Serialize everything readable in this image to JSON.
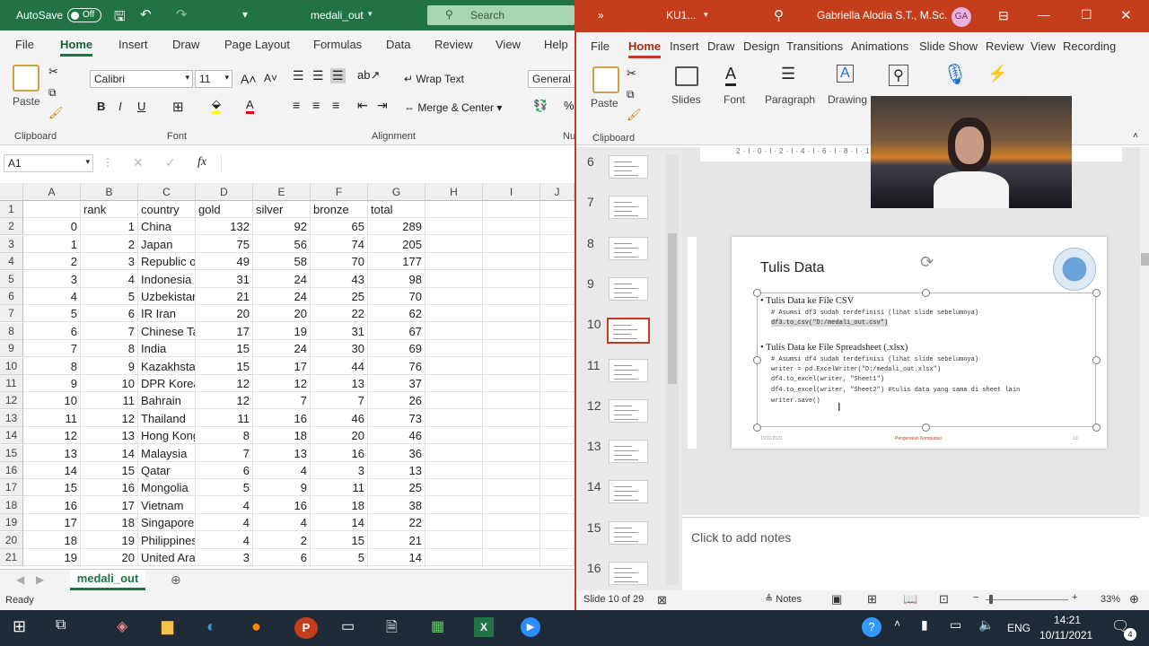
{
  "excel": {
    "title": {
      "autosave": "AutoSave",
      "toggle": "Off",
      "filename": "medali_out",
      "search": "Search"
    },
    "menu": [
      "File",
      "Home",
      "Insert",
      "Draw",
      "Page Layout",
      "Formulas",
      "Data",
      "Review",
      "View",
      "Help"
    ],
    "ribbon": {
      "paste": "Paste",
      "clipboard": "Clipboard",
      "font_name": "Calibri",
      "font_size": "11",
      "font": "Font",
      "wrap": "Wrap Text",
      "merge": "Merge & Center",
      "alignment": "Alignment",
      "number_format": "General",
      "number": "Nu"
    },
    "namebox": "A1",
    "fx": "fx",
    "columns": [
      "A",
      "B",
      "C",
      "D",
      "E",
      "F",
      "G",
      "H",
      "I",
      "J"
    ],
    "header_row": [
      "",
      "rank",
      "country",
      "gold",
      "silver",
      "bronze",
      "total"
    ],
    "rows": [
      [
        "0",
        "1",
        "China",
        "132",
        "92",
        "65",
        "289"
      ],
      [
        "1",
        "2",
        "Japan",
        "75",
        "56",
        "74",
        "205"
      ],
      [
        "2",
        "3",
        "Republic o",
        "49",
        "58",
        "70",
        "177"
      ],
      [
        "3",
        "4",
        "Indonesia",
        "31",
        "24",
        "43",
        "98"
      ],
      [
        "4",
        "5",
        "Uzbekistar",
        "21",
        "24",
        "25",
        "70"
      ],
      [
        "5",
        "6",
        "IR Iran",
        "20",
        "20",
        "22",
        "62"
      ],
      [
        "6",
        "7",
        "Chinese Ta",
        "17",
        "19",
        "31",
        "67"
      ],
      [
        "7",
        "8",
        "India",
        "15",
        "24",
        "30",
        "69"
      ],
      [
        "8",
        "9",
        "Kazakhsta",
        "15",
        "17",
        "44",
        "76"
      ],
      [
        "9",
        "10",
        "DPR Korea",
        "12",
        "12",
        "13",
        "37"
      ],
      [
        "10",
        "11",
        "Bahrain",
        "12",
        "7",
        "7",
        "26"
      ],
      [
        "11",
        "12",
        "Thailand",
        "11",
        "16",
        "46",
        "73"
      ],
      [
        "12",
        "13",
        "Hong Kong",
        "8",
        "18",
        "20",
        "46"
      ],
      [
        "13",
        "14",
        "Malaysia",
        "7",
        "13",
        "16",
        "36"
      ],
      [
        "14",
        "15",
        "Qatar",
        "6",
        "4",
        "3",
        "13"
      ],
      [
        "15",
        "16",
        "Mongolia",
        "5",
        "9",
        "11",
        "25"
      ],
      [
        "16",
        "17",
        "Vietnam",
        "4",
        "16",
        "18",
        "38"
      ],
      [
        "17",
        "18",
        "Singapore",
        "4",
        "4",
        "14",
        "22"
      ],
      [
        "18",
        "19",
        "Philippines",
        "4",
        "2",
        "15",
        "21"
      ],
      [
        "19",
        "20",
        "United Ara",
        "3",
        "6",
        "5",
        "14"
      ]
    ],
    "sheet_tab": "medali_out",
    "status": "Ready"
  },
  "ppt": {
    "title": {
      "filename": "KU1...",
      "user": "Gabriella Alodia S.T., M.Sc.",
      "initials": "GA"
    },
    "menu": [
      "File",
      "Home",
      "Insert",
      "Draw",
      "Design",
      "Transitions",
      "Animations",
      "Slide Show",
      "Review",
      "View",
      "Recording"
    ],
    "ribbon": {
      "paste": "Paste",
      "slides": "Slides",
      "font": "Font",
      "paragraph": "Paragraph",
      "drawing": "Drawing",
      "clipboard": "Clipboard"
    },
    "slide_numbers": [
      "6",
      "7",
      "8",
      "9",
      "10",
      "11",
      "12",
      "13",
      "14",
      "15",
      "16"
    ],
    "slide": {
      "title": "Tulis Data",
      "bullet1": "Tulis Data ke File CSV",
      "code1": [
        "# Asumsi df3 sudah terdefinisi (lihat slide sebelumnya)",
        "df3.to_csv(\"D:/medali_out.csv\")"
      ],
      "bullet2": "Tulis Data ke File Spreadsheet (.xlsx)",
      "code2": [
        "# Asumsi df4 sudah terdefinisi (lihat slide sebelumnya)",
        "writer = pd.ExcelWriter(\"D:/medali_out.xlsx\")",
        "df4.to_excel(writer, \"Sheet1\")",
        "df4.to_excel(writer, \"Sheet2\") #tulis data yang sama di sheet lain",
        "writer.save()"
      ],
      "footer_left": "10/11/2021",
      "footer_mid": "Pengenalan Komputasi",
      "footer_right": "10"
    },
    "notes_placeholder": "Click to add notes",
    "status_slide": "Slide 10 of 29",
    "notes_btn": "Notes",
    "zoom": "33%"
  },
  "taskbar": {
    "lang": "ENG",
    "time": "14:21",
    "date": "10/11/2021",
    "notif": "4"
  },
  "colors": {
    "excel_green": "#217346",
    "ppt_red": "#c43e1c",
    "taskbar": "#1f2b36"
  }
}
